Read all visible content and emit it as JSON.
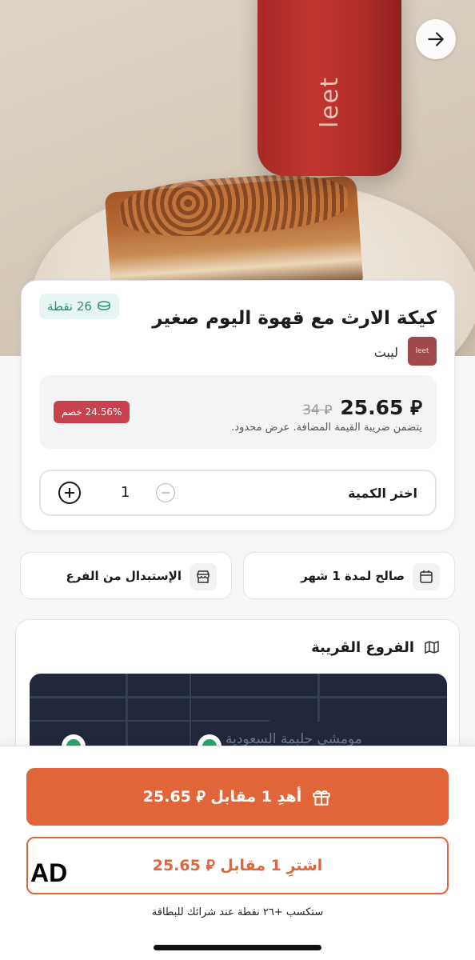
{
  "hero": {
    "cup_brand": "leet"
  },
  "product": {
    "points_label": "26 نقطة",
    "title": "كيكة الارث مع قهوة اليوم صغير",
    "brand_logo_text": "leet",
    "brand_name": "ليبت",
    "price_new": "25.65",
    "price_old": "34",
    "currency_symbol": "⃁",
    "vat_note": "يتضمن ضريبة القيمة المضافة. عرض محدود.",
    "discount": "24.56% خصم",
    "quantity_label": "اختر الكمية",
    "quantity_value": "1"
  },
  "info": {
    "validity": "صالح لمدة 1 شهر",
    "redeem": "الإستبدال من الفرع"
  },
  "branches": {
    "title": "الفروع القريبة",
    "map_label": "مومشي حلبمة السعودية"
  },
  "actions": {
    "gift_label": "أهدِ 1 مقابل ⃁ 25.65",
    "buy_label": "اشترِ 1 مقابل ⃁ 25.65",
    "ad_label": "AD",
    "earn_note": "ستكسب +٢٦ نقطة عند شرائك للبطاقة"
  },
  "colors": {
    "accent": "#e0663a",
    "discount": "#c7424d",
    "points": "#2b8d7b",
    "brand": "#a3484a"
  }
}
